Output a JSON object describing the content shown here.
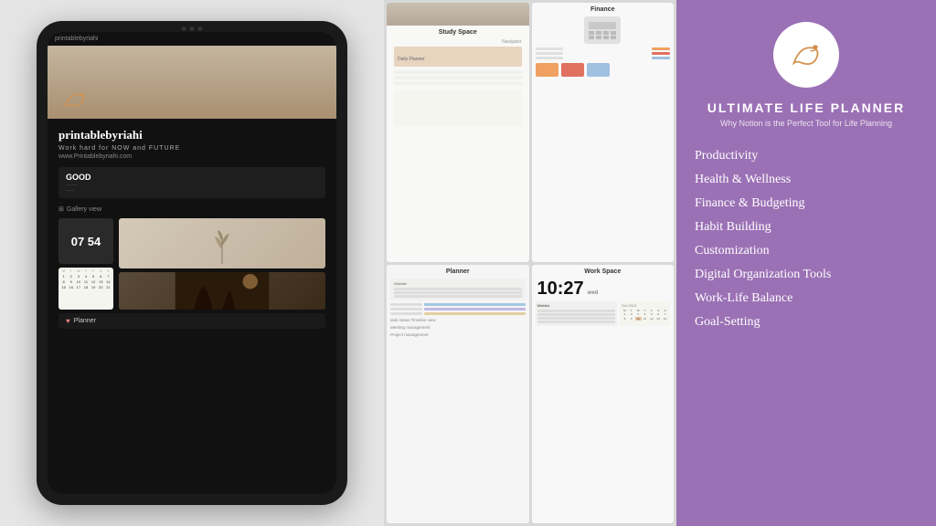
{
  "tablet": {
    "url": "printablebyriahi",
    "title": "printablebyriahi",
    "subtitle": "Work hard for NOW and FUTURE",
    "website": "www.Printablebyriahi.com",
    "good_label": "GOOD",
    "gallery_label": "Gallery view",
    "time_display": "07 54",
    "planner_label": "Planner"
  },
  "screenshots": {
    "study": {
      "title": "Study Space",
      "nav_label": "Navigator",
      "planner_btn": "Daily Planner"
    },
    "finance": {
      "title": "Finance"
    },
    "planner": {
      "title": "Planner",
      "timeline_label": "task status Timeline view",
      "meeting_label": "Meeting management",
      "project_label": "Project management"
    },
    "workspace": {
      "title": "Work Space",
      "time": "10:27",
      "day": "wed"
    }
  },
  "right_panel": {
    "brand_title": "ULTIMATE LIFE PLANNER",
    "brand_subtitle": "Why Notion is the Perfect Tool for Life Planning",
    "features": [
      "Productivity",
      "Health & Wellness",
      "Finance & Budgeting",
      "Habit Building",
      "Customization",
      "Digital Organization Tools",
      "Work-Life Balance",
      "Goal-Setting"
    ]
  },
  "colors": {
    "purple": "#9b71b5",
    "orange_accent": "#d4914e",
    "white": "#ffffff"
  }
}
